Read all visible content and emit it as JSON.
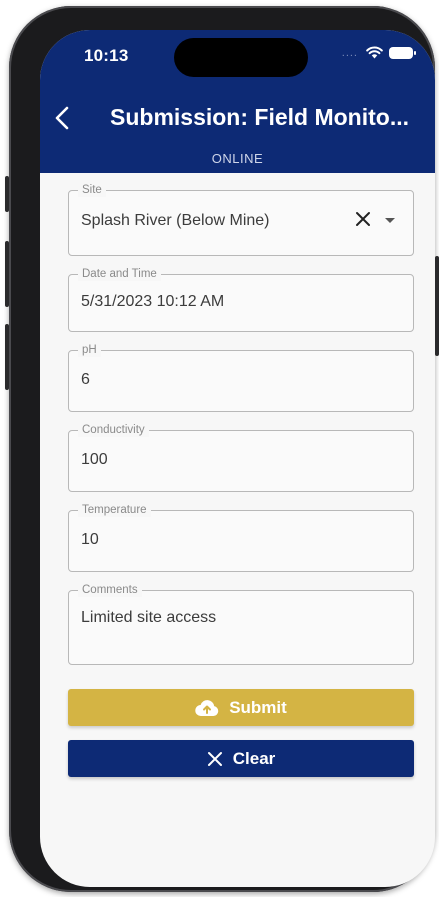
{
  "status_bar": {
    "time": "10:13",
    "signal_dots": "....",
    "icons": [
      "wifi-icon",
      "battery-icon"
    ]
  },
  "header": {
    "back_icon": "chevron-left-icon",
    "title": "Submission: Field Monito...",
    "connection_status": "ONLINE"
  },
  "form": {
    "site": {
      "label": "Site",
      "value": "Splash River (Below Mine)"
    },
    "datetime": {
      "label": "Date and Time",
      "value": "5/31/2023 10:12 AM"
    },
    "ph": {
      "label": "pH",
      "value": "6"
    },
    "conductivity": {
      "label": "Conductivity",
      "value": "100"
    },
    "temperature": {
      "label": "Temperature",
      "value": "10"
    },
    "comments": {
      "label": "Comments",
      "value": "Limited site access"
    }
  },
  "actions": {
    "submit_label": "Submit",
    "submit_icon": "cloud-upload-icon",
    "clear_label": "Clear",
    "clear_icon": "close-icon"
  },
  "colors": {
    "primary": "#0d2a75",
    "submit": "#d4b444",
    "background": "#f7f7f7"
  }
}
